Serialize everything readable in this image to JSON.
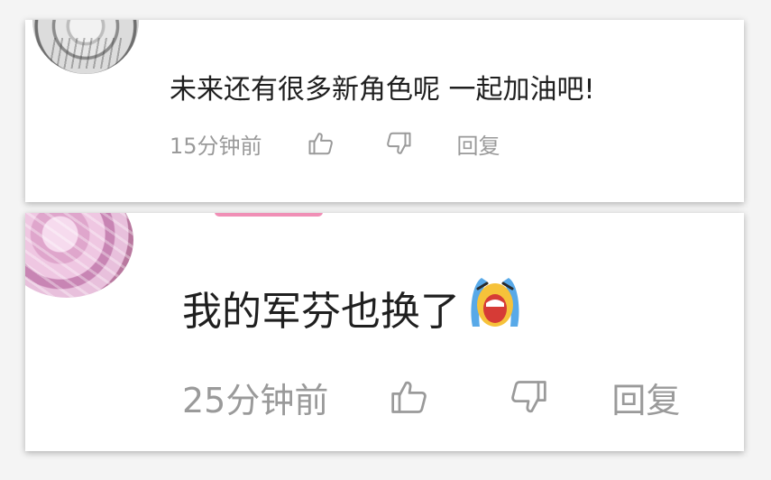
{
  "comments": [
    {
      "text": "未来还有很多新角色呢   一起加油吧!",
      "time": "15分钟前",
      "reply_label": "回复",
      "avatar_icon": "grayscale-character-avatar"
    },
    {
      "text": "我的军芬也换了",
      "emoji": "crying-face-emoji",
      "time": "25分钟前",
      "reply_label": "回复",
      "avatar_icon": "pink-character-avatar"
    }
  ],
  "icons": {
    "like": "thumbs-up-icon",
    "dislike": "thumbs-down-icon"
  },
  "colors": {
    "text": "#1f1f1f",
    "meta": "#9a9a9a",
    "username_accent": "#f08fb6",
    "card": "#ffffff"
  }
}
